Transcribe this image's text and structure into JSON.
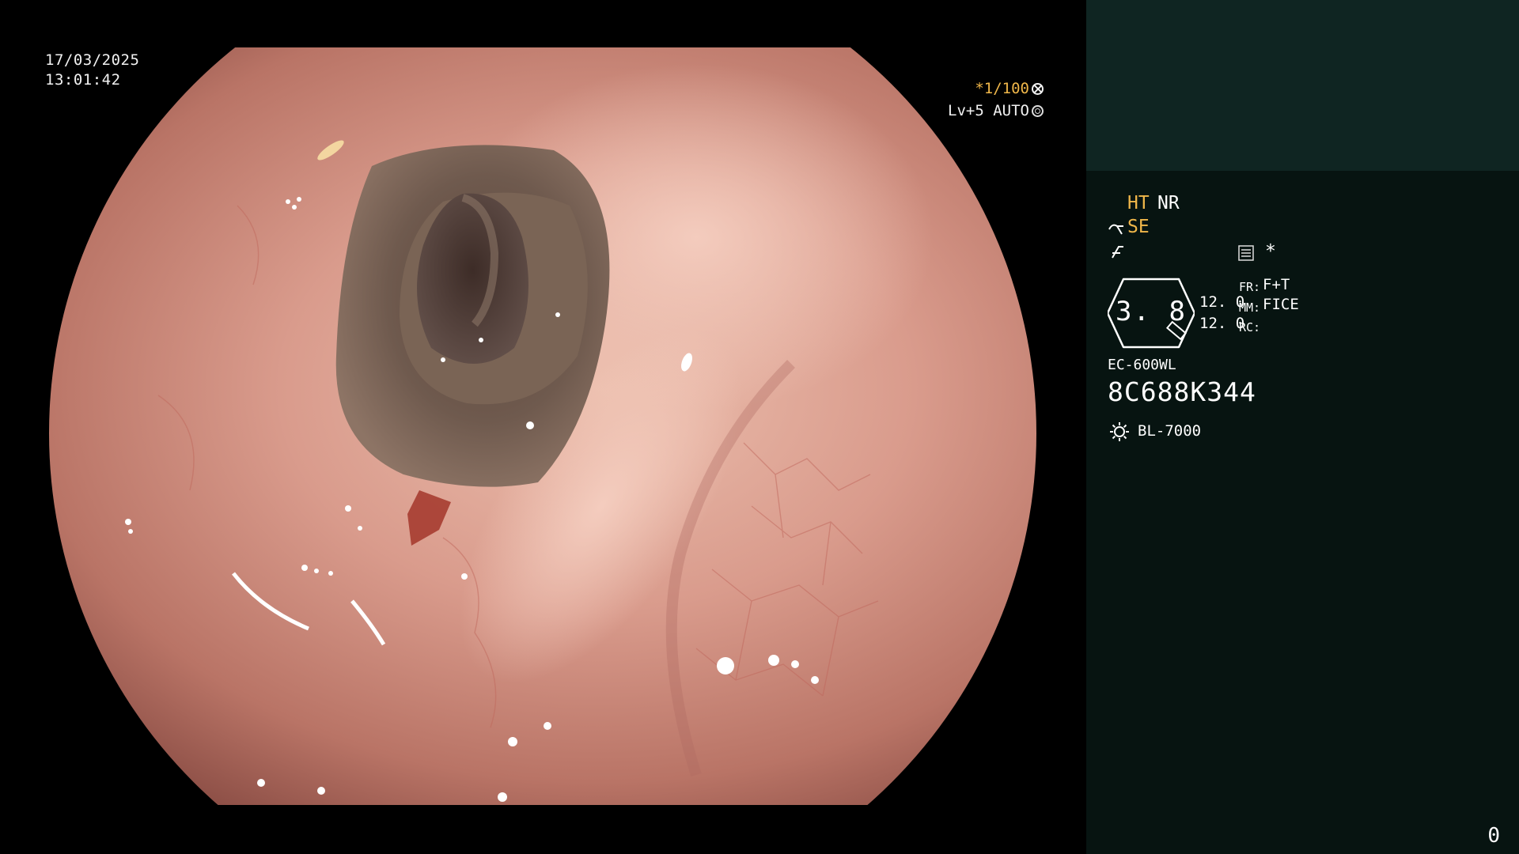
{
  "overlay": {
    "date": "17/03/2025",
    "time": "13:01:42",
    "shutter": "*1/100",
    "level": "Lv+5 AUTO"
  },
  "panel": {
    "mode_ht": "HT",
    "mode_nr": "NR",
    "mode_se": "SE",
    "mode_star": "*",
    "zoom_value": "3. 8",
    "val_1": "12. 0",
    "val_2": "12. 0",
    "fr_label": "FR:",
    "fr_value": "F+T",
    "mm_label": "MM:",
    "mm_value": "FICE",
    "rc_label": "RC:",
    "scope_model": "EC-600WL",
    "scope_serial": "8C688K344",
    "light_source": "BL-7000",
    "counter": "0"
  },
  "colors": {
    "panel_bg": "#071411",
    "panel_top_bg": "#0f2522",
    "accent_yellow": "#f0b74a"
  },
  "icons": [
    "aperture-icon",
    "wheel-icon",
    "scope-tip-icon",
    "flex-icon",
    "menu-icon",
    "zoom-ring-icon",
    "light-source-icon"
  ]
}
